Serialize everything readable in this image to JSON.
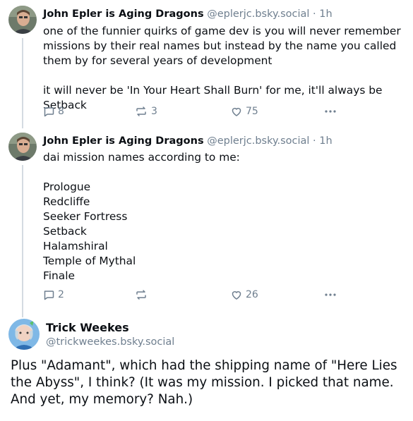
{
  "posts": [
    {
      "author": "John Epler is Aging Dragons",
      "handle": "@eplerjc.bsky.social",
      "separator": "·",
      "time": "1h",
      "text": "one of the funnier quirks of game dev is you will never remember missions by their real names but instead by the name you called them by for several years of development\n\nit will never be 'In Your Heart Shall Burn' for me, it'll always be Setback",
      "replies": "8",
      "reposts": "3",
      "likes": "75"
    },
    {
      "author": "John Epler is Aging Dragons",
      "handle": "@eplerjc.bsky.social",
      "separator": "·",
      "time": "1h",
      "text": "dai mission names according to me:\n\nPrologue\nRedcliffe\nSeeker Fortress\nSetback\nHalamshiral\nTemple of Mythal\nFinale",
      "replies": "2",
      "reposts": "",
      "likes": "26"
    }
  ],
  "focused": {
    "author": "Trick Weekes",
    "handle": "@trickweekes.bsky.social",
    "text": "Plus \"Adamant\", which had the shipping name of \"Here Lies the Abyss\", I think? (It was my mission. I picked that name. And yet, my memory? Nah.)"
  },
  "icons": [
    "avatar",
    "reply-icon",
    "repost-icon",
    "like-icon",
    "more-icon"
  ],
  "colors": {
    "muted": "#6f7f8f",
    "text": "#0b0f14",
    "thread_line": "#d4dbe2"
  }
}
